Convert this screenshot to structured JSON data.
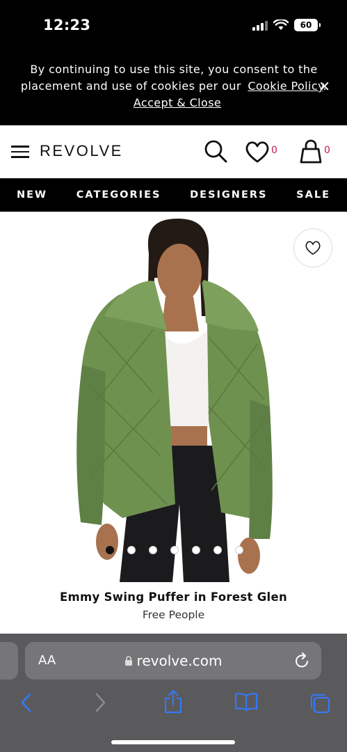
{
  "status_bar": {
    "time": "12:23",
    "battery": "60"
  },
  "cookie_banner": {
    "text": "By continuing to use this site, you consent to the placement and use of cookies per our",
    "link_label": "Cookie Policy",
    "accept_label": "Accept & Close",
    "close_symbol": "✕"
  },
  "header": {
    "logo": "REVOLVE",
    "wishlist_count": "0",
    "bag_count": "0"
  },
  "nav": {
    "items": [
      {
        "label": "NEW"
      },
      {
        "label": "CATEGORIES"
      },
      {
        "label": "DESIGNERS"
      },
      {
        "label": "SALE"
      }
    ]
  },
  "product": {
    "name": "Emmy Swing Puffer in Forest Glen",
    "brand": "Free People",
    "image_count": 7,
    "active_image": 1,
    "jacket_color": "#6f9150"
  },
  "browser": {
    "aa_label": "AA",
    "url": "revolve.com"
  },
  "colors": {
    "accent_count": "#c2185b",
    "safari_bg": "#5a5a5c",
    "safari_icon": "#3478f6"
  }
}
